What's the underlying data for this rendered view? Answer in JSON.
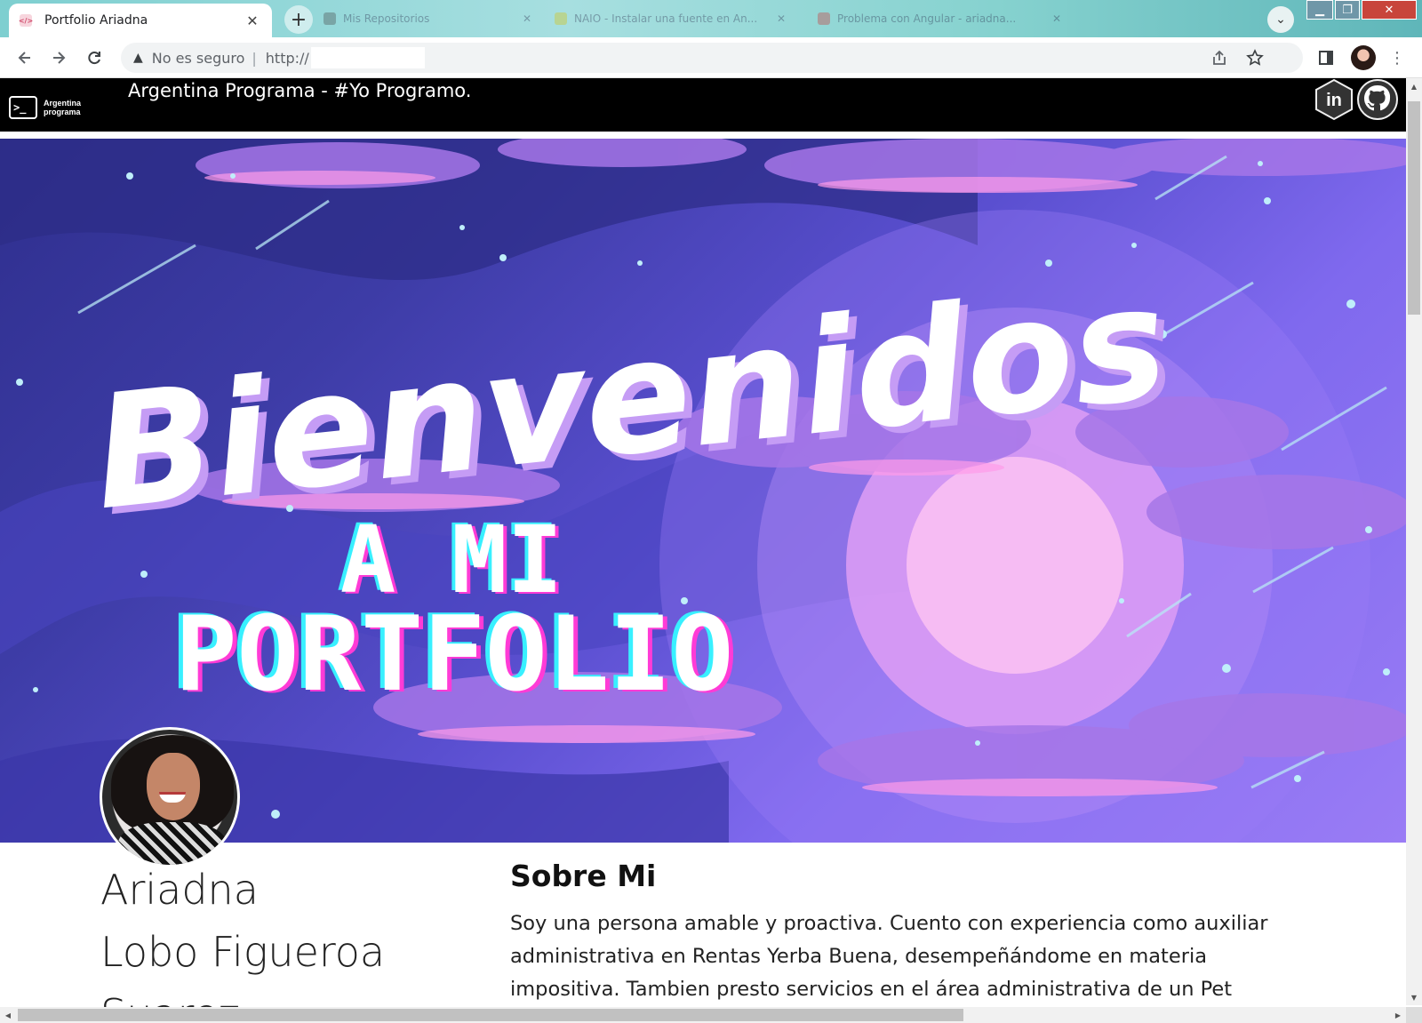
{
  "browser": {
    "active_tab": {
      "title": "Portfolio Ariadna"
    },
    "background_tabs": [
      {
        "title": "Mis Repositorios"
      },
      {
        "title": "NAIO - Instalar una fuente en An..."
      },
      {
        "title": "Problema con Angular - ariadna..."
      }
    ],
    "omnibox": {
      "security": "No es seguro",
      "url": "http://"
    },
    "icons": {
      "back": "arrow-left-icon",
      "forward": "arrow-right-icon",
      "reload": "reload-icon",
      "share": "share-icon",
      "bookmark": "star-icon",
      "sidepanel": "side-panel-icon",
      "menu": "kebab-menu-icon"
    }
  },
  "header": {
    "logo_line1": "Argentina",
    "logo_line2": "programa",
    "logo_prompt": ">_",
    "title": "Argentina Programa - #Yo Programo.",
    "social": [
      {
        "name": "linkedin",
        "label": "in"
      },
      {
        "name": "github",
        "label": ""
      }
    ]
  },
  "hero": {
    "headline": "Bienvenidos",
    "subline1": "A MI",
    "subline2": "PORTFOLIO"
  },
  "profile": {
    "name_lines": [
      "Ariadna",
      "Lobo Figueroa",
      "Suarez"
    ]
  },
  "about": {
    "title": "Sobre Mi",
    "text": "Soy una persona amable y proactiva. Cuento con experiencia como auxiliar administrativa en Rentas Yerba Buena, desempeñándome en materia impositiva. Tambien presto servicios en el área administrativa de un Pet"
  },
  "colors": {
    "header_bg": "#000000",
    "hero_accent": "#7f69ee",
    "moon": "#f2a7f2",
    "headline_shadow": "#c59cf5"
  }
}
